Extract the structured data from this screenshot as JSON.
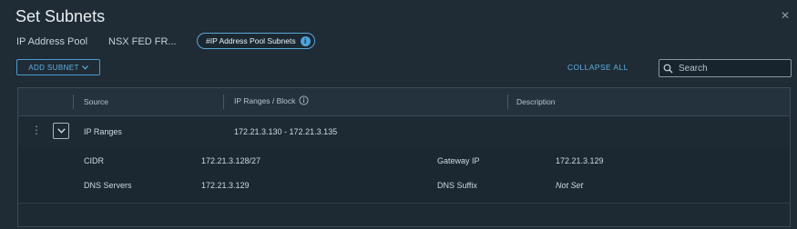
{
  "dialog": {
    "title": "Set Subnets",
    "close_icon": "close-icon"
  },
  "breadcrumb": {
    "pool_label": "IP Address Pool",
    "pool_name": "NSX FED FR...",
    "pill_label": "#IP Address Pool Subnets",
    "pill_info": "i"
  },
  "toolbar": {
    "add_subnet_label": "ADD SUBNET",
    "collapse_all_label": "COLLAPSE ALL",
    "search_placeholder": "Search"
  },
  "table": {
    "columns": [
      "Source",
      "IP Ranges / Block",
      "Description"
    ],
    "ip_header_info": "i",
    "rows": [
      {
        "source": "IP Ranges",
        "ip_ranges": "172.21.3.130 - 172.21.3.135",
        "description": "",
        "expanded": true,
        "details": {
          "cidr_label": "CIDR",
          "cidr_value": "172.21.3.128/27",
          "gateway_label": "Gateway IP",
          "gateway_value": "172.21.3.129",
          "dns_servers_label": "DNS Servers",
          "dns_servers_value": "172.21.3.129",
          "dns_suffix_label": "DNS Suffix",
          "dns_suffix_value": "Not Set"
        }
      }
    ]
  },
  "colors": {
    "background": "#1f2b35",
    "accent": "#5fb3e6",
    "border": "#3b4a55"
  }
}
